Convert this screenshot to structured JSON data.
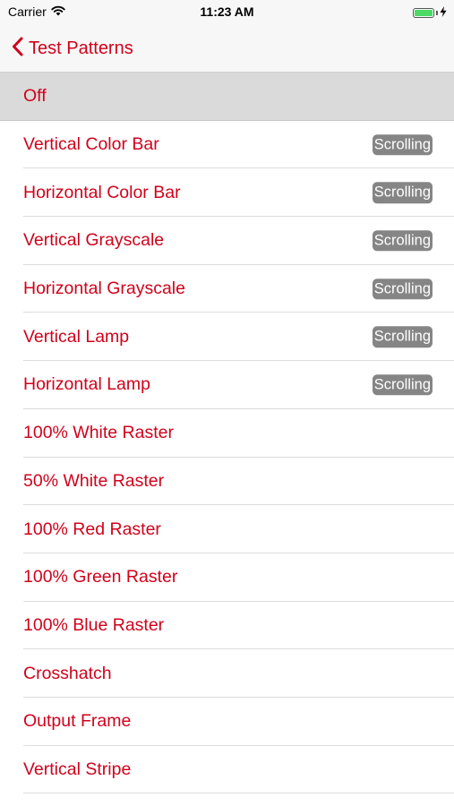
{
  "status_bar": {
    "carrier": "Carrier",
    "time": "11:23 AM",
    "battery_level": 1.0,
    "charging": true,
    "battery_color": "#4cd964"
  },
  "nav": {
    "back_label": "Test Patterns",
    "back_icon": "chevron-left-icon",
    "accent_color": "#d0021b"
  },
  "list": {
    "selected_index": 0,
    "items": [
      {
        "label": "Off",
        "badge": ""
      },
      {
        "label": "Vertical Color Bar",
        "badge": "Scrolling"
      },
      {
        "label": "Horizontal Color Bar",
        "badge": "Scrolling"
      },
      {
        "label": "Vertical Grayscale",
        "badge": "Scrolling"
      },
      {
        "label": "Horizontal Grayscale",
        "badge": "Scrolling"
      },
      {
        "label": "Vertical Lamp",
        "badge": "Scrolling"
      },
      {
        "label": "Horizontal Lamp",
        "badge": "Scrolling"
      },
      {
        "label": "100% White Raster",
        "badge": ""
      },
      {
        "label": "50% White Raster",
        "badge": ""
      },
      {
        "label": "100% Red Raster",
        "badge": ""
      },
      {
        "label": "100% Green Raster",
        "badge": ""
      },
      {
        "label": "100% Blue Raster",
        "badge": ""
      },
      {
        "label": "Crosshatch",
        "badge": ""
      },
      {
        "label": "Output Frame",
        "badge": ""
      },
      {
        "label": "Vertical Stripe",
        "badge": ""
      }
    ]
  }
}
